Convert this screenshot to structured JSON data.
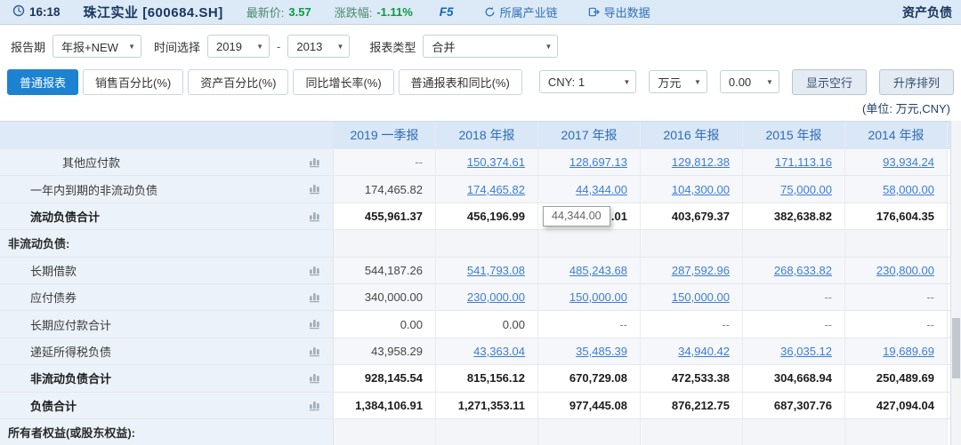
{
  "topbar": {
    "time": "16:18",
    "stock": "珠江实业 [600684.SH]",
    "price_label": "最新价:",
    "price": "3.57",
    "change_label": "涨跌幅:",
    "change": "-1.11%",
    "f5": "F5",
    "industry_chain": "所属产业链",
    "export_data": "导出数据",
    "page_title": "资产负债"
  },
  "filters": {
    "report_period_label": "报告期",
    "report_period_value": "年报+NEW",
    "time_select_label": "时间选择",
    "year_from": "2019",
    "range_separator": "-",
    "year_to": "2013",
    "report_type_label": "报表类型",
    "report_type_value": "合并"
  },
  "toolbar": {
    "tabs": [
      {
        "label": "普通报表",
        "active": true
      },
      {
        "label": "销售百分比(%)",
        "active": false
      },
      {
        "label": "资产百分比(%)",
        "active": false
      },
      {
        "label": "同比增长率(%)",
        "active": false
      },
      {
        "label": "普通报表和同比(%)",
        "active": false
      }
    ],
    "currency_value": "CNY: 1",
    "unit_value": "万元",
    "decimal_value": "0.00",
    "show_empty_label": "显示空行",
    "sort_label": "升序排列"
  },
  "unit_note": "(单位: 万元,CNY)",
  "table": {
    "columns": [
      "",
      "2019 一季报",
      "2018 年报",
      "2017 年报",
      "2016 年报",
      "2015 年报",
      "2014 年报"
    ],
    "tooltip": {
      "text": "44,344.00",
      "row": 2,
      "col": 2
    },
    "rows": [
      {
        "label": "其他应付款",
        "indent": 2,
        "bold": false,
        "section": false,
        "cells": [
          {
            "text": "--",
            "link": false
          },
          {
            "text": "150,374.61",
            "link": true
          },
          {
            "text": "128,697.13",
            "link": true
          },
          {
            "text": "129,812.38",
            "link": true
          },
          {
            "text": "171,113.16",
            "link": true
          },
          {
            "text": "93,934.24",
            "link": true
          }
        ]
      },
      {
        "label": "一年内到期的非流动负债",
        "indent": 1,
        "bold": false,
        "section": false,
        "cells": [
          {
            "text": "174,465.82",
            "link": false
          },
          {
            "text": "174,465.82",
            "link": true
          },
          {
            "text": "44,344.00",
            "link": true
          },
          {
            "text": "104,300.00",
            "link": true
          },
          {
            "text": "75,000.00",
            "link": true
          },
          {
            "text": "58,000.00",
            "link": true
          }
        ]
      },
      {
        "label": "流动负债合计",
        "indent": 1,
        "bold": true,
        "section": false,
        "cells": [
          {
            "text": "455,961.37",
            "link": false
          },
          {
            "text": "456,196.99",
            "link": false
          },
          {
            "text": ".01",
            "link": false
          },
          {
            "text": "403,679.37",
            "link": false
          },
          {
            "text": "382,638.82",
            "link": false
          },
          {
            "text": "176,604.35",
            "link": false
          }
        ]
      },
      {
        "label": "非流动负债:",
        "indent": 0,
        "bold": false,
        "section": true,
        "cells": [
          {
            "text": "",
            "link": false
          },
          {
            "text": "",
            "link": false
          },
          {
            "text": "",
            "link": false
          },
          {
            "text": "",
            "link": false
          },
          {
            "text": "",
            "link": false
          },
          {
            "text": "",
            "link": false
          }
        ]
      },
      {
        "label": "长期借款",
        "indent": 1,
        "bold": false,
        "section": false,
        "cells": [
          {
            "text": "544,187.26",
            "link": false
          },
          {
            "text": "541,793.08",
            "link": true
          },
          {
            "text": "485,243.68",
            "link": true
          },
          {
            "text": "287,592.96",
            "link": true
          },
          {
            "text": "268,633.82",
            "link": true
          },
          {
            "text": "230,800.00",
            "link": true
          }
        ]
      },
      {
        "label": "应付债券",
        "indent": 1,
        "bold": false,
        "section": false,
        "cells": [
          {
            "text": "340,000.00",
            "link": false
          },
          {
            "text": "230,000.00",
            "link": true
          },
          {
            "text": "150,000.00",
            "link": true
          },
          {
            "text": "150,000.00",
            "link": true
          },
          {
            "text": "--",
            "link": false
          },
          {
            "text": "--",
            "link": false
          }
        ]
      },
      {
        "label": "长期应付款合计",
        "indent": 1,
        "bold": false,
        "section": false,
        "cells": [
          {
            "text": "0.00",
            "link": false
          },
          {
            "text": "0.00",
            "link": false
          },
          {
            "text": "--",
            "link": false
          },
          {
            "text": "--",
            "link": false
          },
          {
            "text": "--",
            "link": false
          },
          {
            "text": "--",
            "link": false
          }
        ]
      },
      {
        "label": "递延所得税负债",
        "indent": 1,
        "bold": false,
        "section": false,
        "cells": [
          {
            "text": "43,958.29",
            "link": false
          },
          {
            "text": "43,363.04",
            "link": true
          },
          {
            "text": "35,485.39",
            "link": true
          },
          {
            "text": "34,940.42",
            "link": true
          },
          {
            "text": "36,035.12",
            "link": true
          },
          {
            "text": "19,689.69",
            "link": true
          }
        ]
      },
      {
        "label": "非流动负债合计",
        "indent": 1,
        "bold": true,
        "section": false,
        "cells": [
          {
            "text": "928,145.54",
            "link": false
          },
          {
            "text": "815,156.12",
            "link": false
          },
          {
            "text": "670,729.08",
            "link": false
          },
          {
            "text": "472,533.38",
            "link": false
          },
          {
            "text": "304,668.94",
            "link": false
          },
          {
            "text": "250,489.69",
            "link": false
          }
        ]
      },
      {
        "label": "负债合计",
        "indent": 1,
        "bold": true,
        "section": false,
        "cells": [
          {
            "text": "1,384,106.91",
            "link": false
          },
          {
            "text": "1,271,353.11",
            "link": false
          },
          {
            "text": "977,445.08",
            "link": false
          },
          {
            "text": "876,212.75",
            "link": false
          },
          {
            "text": "687,307.76",
            "link": false
          },
          {
            "text": "427,094.04",
            "link": false
          }
        ]
      },
      {
        "label": "所有者权益(或股东权益):",
        "indent": 0,
        "bold": false,
        "section": true,
        "cells": [
          {
            "text": "",
            "link": false
          },
          {
            "text": "",
            "link": false
          },
          {
            "text": "",
            "link": false
          },
          {
            "text": "",
            "link": false
          },
          {
            "text": "",
            "link": false
          },
          {
            "text": "",
            "link": false
          }
        ]
      }
    ]
  }
}
